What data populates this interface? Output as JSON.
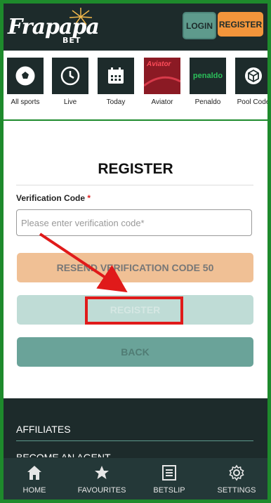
{
  "header": {
    "logo_text": "Frapapa",
    "logo_sub": "BET",
    "login_label": "LOGIN",
    "register_label": "REGISTER"
  },
  "categories": [
    {
      "label": "All sports",
      "icon": "soccer-ball-icon"
    },
    {
      "label": "Live",
      "icon": "clock-icon"
    },
    {
      "label": "Today",
      "icon": "calendar-icon"
    },
    {
      "label": "Aviator",
      "icon": "aviator-thumbnail",
      "art_text": "Aviator"
    },
    {
      "label": "Penaldo",
      "icon": "penaldo-thumbnail",
      "art_text": "penaldo"
    },
    {
      "label": "Pool Code",
      "icon": "cube-icon"
    }
  ],
  "form": {
    "title": "REGISTER",
    "field_label": "Verification Code",
    "required_mark": "*",
    "field_placeholder": "Please enter verification code*",
    "field_value": "",
    "resend_label": "RESEND VERIFICATION CODE 50",
    "register_label": "REGISTER",
    "back_label": "BACK"
  },
  "footer": {
    "links": [
      "AFFILIATES",
      "BECOME AN AGENT"
    ]
  },
  "bottom_nav": [
    {
      "label": "HOME",
      "icon": "home-icon"
    },
    {
      "label": "FAVOURITES",
      "icon": "star-icon"
    },
    {
      "label": "BETSLIP",
      "icon": "betslip-icon"
    },
    {
      "label": "SETTINGS",
      "icon": "gear-icon"
    }
  ],
  "colors": {
    "header_bg": "#1d2b2b",
    "accent_orange": "#f2953b",
    "accent_teal": "#5e9a8c",
    "annotation_red": "#e01a1a",
    "frame_green": "#1e8a2c"
  }
}
